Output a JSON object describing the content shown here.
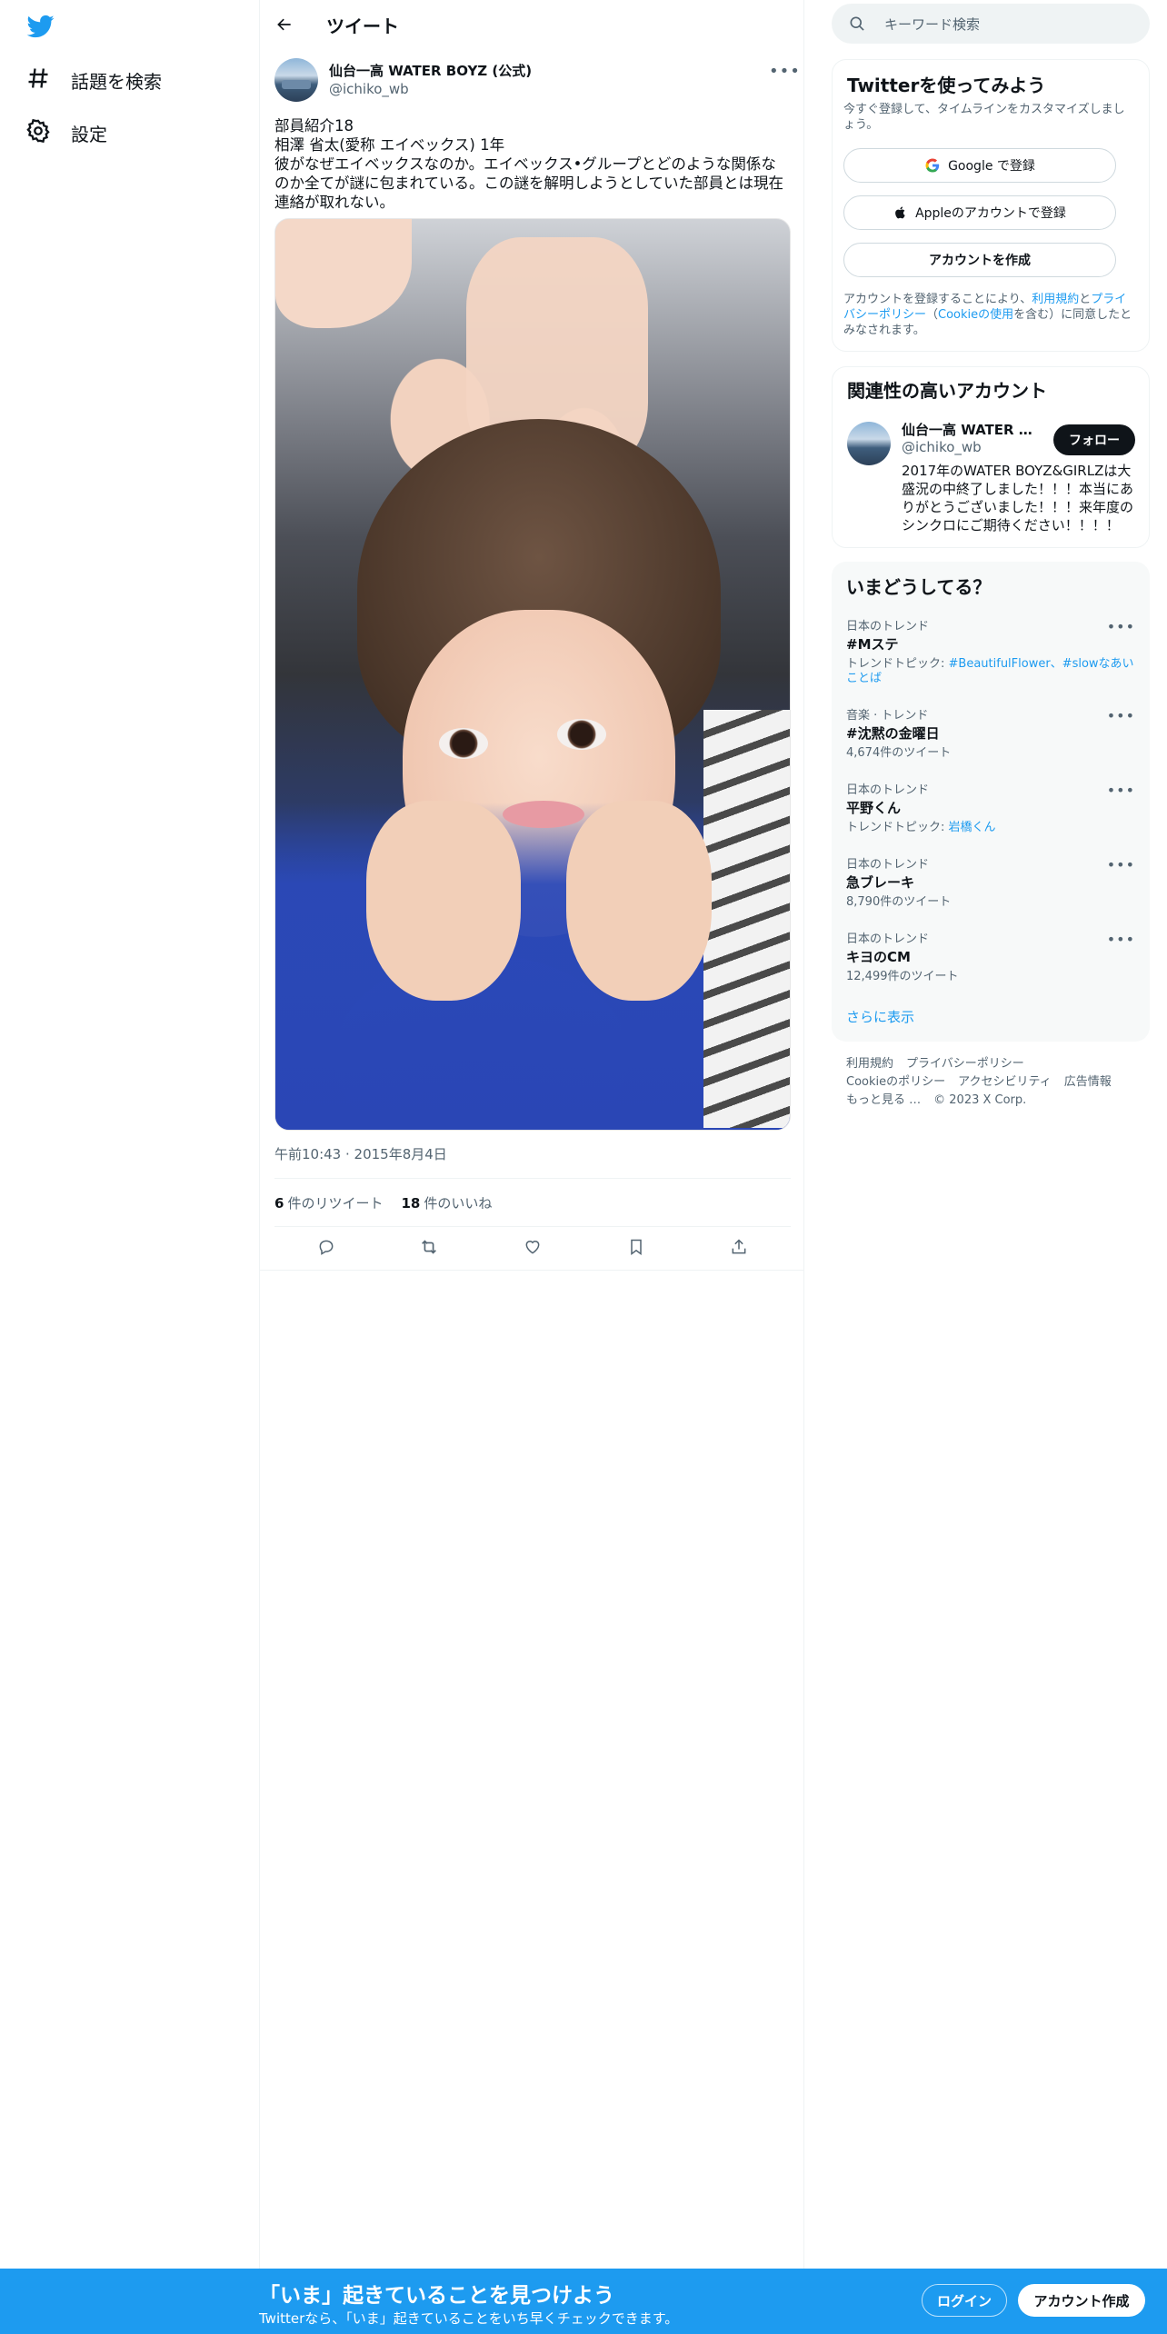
{
  "nav": {
    "items": [
      {
        "label": "話題を検索",
        "icon": "hashtag-icon"
      },
      {
        "label": "設定",
        "icon": "gear-icon"
      }
    ]
  },
  "header": {
    "title": "ツイート"
  },
  "tweet": {
    "author_name": "仙台一高 WATER BOYZ (公式)",
    "author_handle": "@ichiko_wb",
    "text": "部員紹介18\n相澤 省太(愛称 エイベックス) 1年\n彼がなぜエイベックスなのか。エイベックス•グループとどのような関係なのか全てが謎に包まれている。この謎を解明しようとしていた部員とは現在連絡が取れない。",
    "timestamp": "午前10:43 · 2015年8月4日",
    "retweets_count": "6",
    "retweets_label": "件のリツイート",
    "likes_count": "18",
    "likes_label": "件のいいね"
  },
  "search": {
    "placeholder": "キーワード検索"
  },
  "signup_card": {
    "title": "Twitterを使ってみよう",
    "subtitle": "今すぐ登録して、タイムラインをカスタマイズしましょう。",
    "google_label": "Google で登録",
    "apple_label": "Appleのアカウントで登録",
    "create_label": "アカウントを作成",
    "note_prefix": "アカウントを登録することにより、",
    "note_terms": "利用規約",
    "note_and": "と",
    "note_privacy": "プライバシーポリシー",
    "note_paren_open": "（",
    "note_cookie": "Cookieの使用",
    "note_suffix": "を含む）に同意したとみなされます。"
  },
  "related_card": {
    "title": "関連性の高いアカウント",
    "name": "仙台一高 WATER BOYZ (公式)",
    "handle": "@ichiko_wb",
    "follow_label": "フォロー",
    "bio": "2017年のWATER BOYZ&GIRLZは大盛況の中終了しました！！！本当にありがとうございました！！！来年度のシンクロにご期待ください！！！！"
  },
  "trends_card": {
    "title": "いまどうしてる？",
    "items": [
      {
        "context": "日本のトレンド",
        "name": "#Mステ",
        "meta_prefix": "トレンドトピック: ",
        "meta_link": "#BeautifulFlower、#slowなあいことば"
      },
      {
        "context": "音楽 · トレンド",
        "name": "#沈黙の金曜日",
        "meta": "4,674件のツイート"
      },
      {
        "context": "日本のトレンド",
        "name": "平野くん",
        "meta_prefix": "トレンドトピック: ",
        "meta_link": "岩橋くん"
      },
      {
        "context": "日本のトレンド",
        "name": "急ブレーキ",
        "meta": "8,790件のツイート"
      },
      {
        "context": "日本のトレンド",
        "name": "キヨのCM",
        "meta": "12,499件のツイート"
      }
    ],
    "show_more": "さらに表示"
  },
  "footer": {
    "links": [
      "利用規約",
      "プライバシーポリシー",
      "Cookieのポリシー",
      "アクセシビリティ",
      "広告情報",
      "もっと見る …"
    ],
    "copyright": "© 2023 X Corp."
  },
  "bottom_bar": {
    "title": "「いま」起きていることを見つけよう",
    "subtitle": "Twitterなら、「いま」起きていることをいち早くチェックできます。",
    "login_label": "ログイン",
    "signup_label": "アカウント作成"
  },
  "colors": {
    "brand": "#1d9bf0",
    "text": "#0f1419",
    "muted": "#536471"
  }
}
